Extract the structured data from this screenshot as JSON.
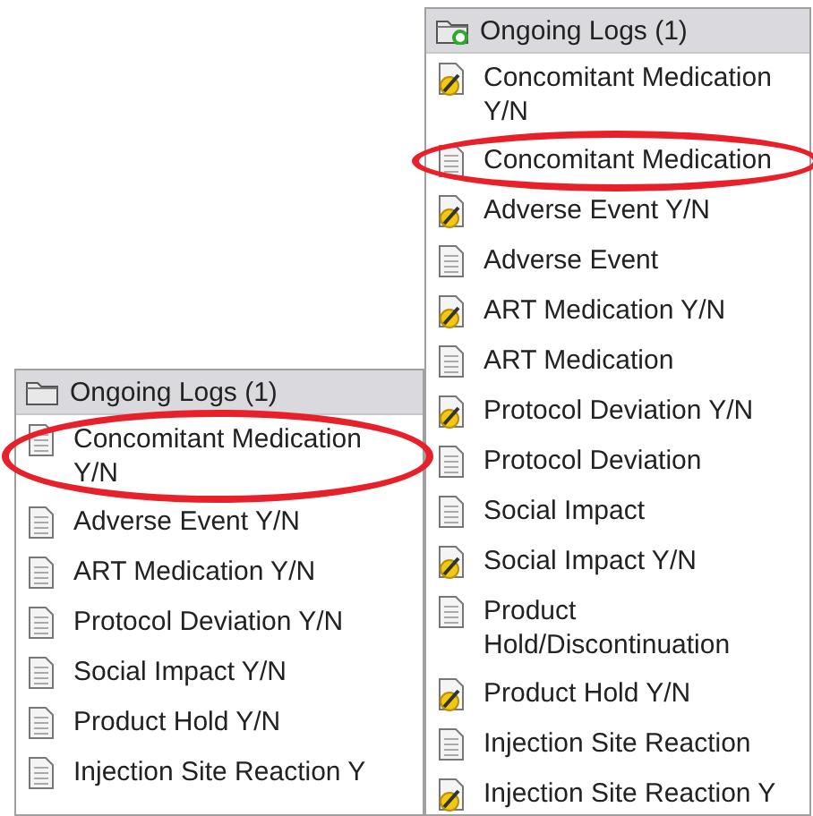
{
  "panels": [
    {
      "header": {
        "label": "Ongoing Logs (1)",
        "kind": "folder"
      },
      "items": [
        {
          "label": "Concomitant Medication Y/N",
          "kind": "page",
          "highlighted": true
        },
        {
          "label": "Adverse Event Y/N",
          "kind": "page",
          "highlighted": false
        },
        {
          "label": "ART Medication Y/N",
          "kind": "page",
          "highlighted": false
        },
        {
          "label": "Protocol Deviation Y/N",
          "kind": "page",
          "highlighted": false
        },
        {
          "label": "Social Impact Y/N",
          "kind": "page",
          "highlighted": false
        },
        {
          "label": "Product Hold Y/N",
          "kind": "page",
          "highlighted": false
        },
        {
          "label": "Injection Site Reaction Y",
          "kind": "page",
          "highlighted": false
        }
      ]
    },
    {
      "header": {
        "label": "Ongoing Logs (1)",
        "kind": "folder-new"
      },
      "items": [
        {
          "label": "Concomitant Medication Y/N",
          "kind": "edit",
          "highlighted": false
        },
        {
          "label": "Concomitant Medication",
          "kind": "page",
          "highlighted": true
        },
        {
          "label": "Adverse Event Y/N",
          "kind": "edit",
          "highlighted": false
        },
        {
          "label": "Adverse Event",
          "kind": "page",
          "highlighted": false
        },
        {
          "label": "ART Medication Y/N",
          "kind": "edit",
          "highlighted": false
        },
        {
          "label": "ART Medication",
          "kind": "page",
          "highlighted": false
        },
        {
          "label": "Protocol Deviation Y/N",
          "kind": "edit",
          "highlighted": false
        },
        {
          "label": "Protocol Deviation",
          "kind": "page",
          "highlighted": false
        },
        {
          "label": "Social Impact",
          "kind": "page",
          "highlighted": false
        },
        {
          "label": "Social Impact Y/N",
          "kind": "edit",
          "highlighted": false
        },
        {
          "label": "Product Hold/Discontinuation",
          "kind": "page",
          "highlighted": false
        },
        {
          "label": "Product Hold Y/N",
          "kind": "edit",
          "highlighted": false
        },
        {
          "label": "Injection Site Reaction",
          "kind": "page",
          "highlighted": false
        },
        {
          "label": "Injection Site Reaction Y",
          "kind": "edit",
          "highlighted": false
        }
      ]
    }
  ]
}
